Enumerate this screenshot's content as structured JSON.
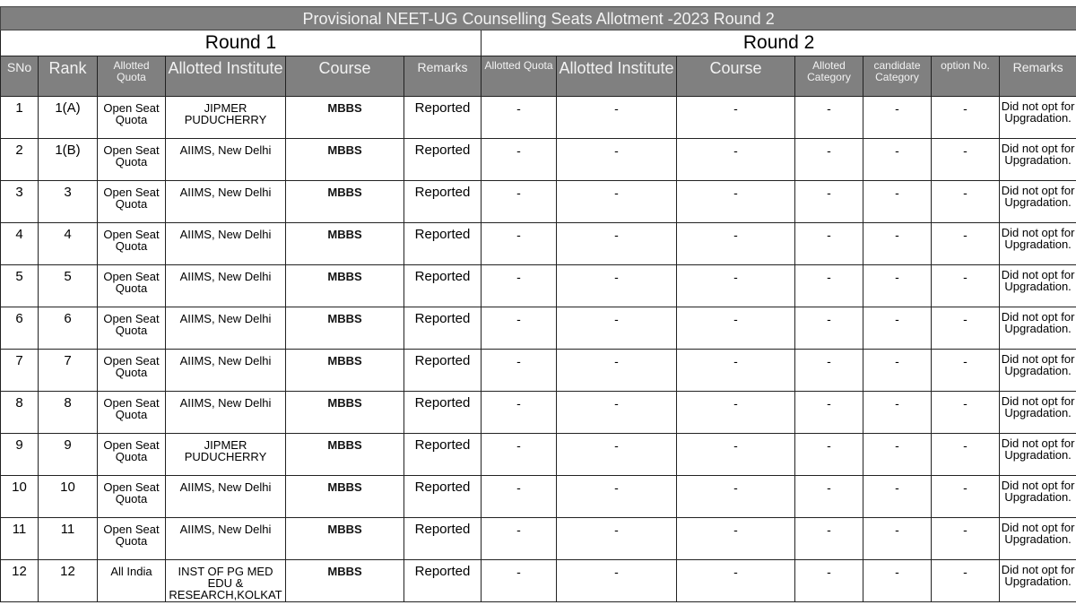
{
  "title": "Provisional NEET-UG  Counselling Seats Allotment -2023 Round 2",
  "round1_label": "Round 1",
  "round2_label": "Round 2",
  "headers": {
    "sno": "SNo",
    "rank": "Rank",
    "r1_quota": "Allotted Quota",
    "r1_institute": "Allotted Institute",
    "r1_course": "Course",
    "r1_remarks": "Remarks",
    "r2_quota": "Allotted Quota",
    "r2_institute": "Allotted Institute",
    "r2_course": "Course",
    "r2_alloted_category": "Alloted Category",
    "r2_candidate_category": "candidate Category",
    "r2_option_no": "option No.",
    "r2_remarks": "Remarks"
  },
  "rows": [
    {
      "sno": "1",
      "rank": "1(A)",
      "quota": "Open Seat Quota",
      "institute": "JIPMER PUDUCHERRY",
      "course": "MBBS",
      "remarks": "Reported",
      "r2_quota": "-",
      "r2_institute": "-",
      "r2_course": "-",
      "r2_alloted_category": "-",
      "r2_candidate_category": "-",
      "r2_option_no": "-",
      "r2_remarks": "Did not opt for Upgradation."
    },
    {
      "sno": "2",
      "rank": "1(B)",
      "quota": "Open Seat Quota",
      "institute": "AIIMS, New Delhi",
      "course": "MBBS",
      "remarks": "Reported",
      "r2_quota": "-",
      "r2_institute": "-",
      "r2_course": "-",
      "r2_alloted_category": "-",
      "r2_candidate_category": "-",
      "r2_option_no": "-",
      "r2_remarks": "Did not opt for Upgradation."
    },
    {
      "sno": "3",
      "rank": "3",
      "quota": "Open Seat Quota",
      "institute": "AIIMS, New Delhi",
      "course": "MBBS",
      "remarks": "Reported",
      "r2_quota": "-",
      "r2_institute": "-",
      "r2_course": "-",
      "r2_alloted_category": "-",
      "r2_candidate_category": "-",
      "r2_option_no": "-",
      "r2_remarks": "Did not opt for Upgradation."
    },
    {
      "sno": "4",
      "rank": "4",
      "quota": "Open Seat Quota",
      "institute": "AIIMS, New Delhi",
      "course": "MBBS",
      "remarks": "Reported",
      "r2_quota": "-",
      "r2_institute": "-",
      "r2_course": "-",
      "r2_alloted_category": "-",
      "r2_candidate_category": "-",
      "r2_option_no": "-",
      "r2_remarks": "Did not opt for Upgradation."
    },
    {
      "sno": "5",
      "rank": "5",
      "quota": "Open Seat Quota",
      "institute": "AIIMS, New Delhi",
      "course": "MBBS",
      "remarks": "Reported",
      "r2_quota": "-",
      "r2_institute": "-",
      "r2_course": "-",
      "r2_alloted_category": "-",
      "r2_candidate_category": "-",
      "r2_option_no": "-",
      "r2_remarks": "Did not opt for Upgradation."
    },
    {
      "sno": "6",
      "rank": "6",
      "quota": "Open Seat Quota",
      "institute": "AIIMS, New Delhi",
      "course": "MBBS",
      "remarks": "Reported",
      "r2_quota": "-",
      "r2_institute": "-",
      "r2_course": "-",
      "r2_alloted_category": "-",
      "r2_candidate_category": "-",
      "r2_option_no": "-",
      "r2_remarks": "Did not opt for Upgradation."
    },
    {
      "sno": "7",
      "rank": "7",
      "quota": "Open Seat Quota",
      "institute": "AIIMS, New Delhi",
      "course": "MBBS",
      "remarks": "Reported",
      "r2_quota": "-",
      "r2_institute": "-",
      "r2_course": "-",
      "r2_alloted_category": "-",
      "r2_candidate_category": "-",
      "r2_option_no": "-",
      "r2_remarks": "Did not opt for Upgradation."
    },
    {
      "sno": "8",
      "rank": "8",
      "quota": "Open Seat Quota",
      "institute": "AIIMS, New Delhi",
      "course": "MBBS",
      "remarks": "Reported",
      "r2_quota": "-",
      "r2_institute": "-",
      "r2_course": "-",
      "r2_alloted_category": "-",
      "r2_candidate_category": "-",
      "r2_option_no": "-",
      "r2_remarks": "Did not opt for Upgradation."
    },
    {
      "sno": "9",
      "rank": "9",
      "quota": "Open Seat Quota",
      "institute": "JIPMER PUDUCHERRY",
      "course": "MBBS",
      "remarks": "Reported",
      "r2_quota": "-",
      "r2_institute": "-",
      "r2_course": "-",
      "r2_alloted_category": "-",
      "r2_candidate_category": "-",
      "r2_option_no": "-",
      "r2_remarks": "Did not opt for Upgradation."
    },
    {
      "sno": "10",
      "rank": "10",
      "quota": "Open Seat Quota",
      "institute": "AIIMS, New Delhi",
      "course": "MBBS",
      "remarks": "Reported",
      "r2_quota": "-",
      "r2_institute": "-",
      "r2_course": "-",
      "r2_alloted_category": "-",
      "r2_candidate_category": "-",
      "r2_option_no": "-",
      "r2_remarks": "Did not opt for Upgradation."
    },
    {
      "sno": "11",
      "rank": "11",
      "quota": "Open Seat Quota",
      "institute": "AIIMS, New Delhi",
      "course": "MBBS",
      "remarks": "Reported",
      "r2_quota": "-",
      "r2_institute": "-",
      "r2_course": "-",
      "r2_alloted_category": "-",
      "r2_candidate_category": "-",
      "r2_option_no": "-",
      "r2_remarks": "Did not opt for Upgradation."
    },
    {
      "sno": "12",
      "rank": "12",
      "quota": "All India",
      "institute": "INST OF PG MED EDU & RESEARCH,KOLKAT",
      "course": "MBBS",
      "remarks": "Reported",
      "r2_quota": "-",
      "r2_institute": "-",
      "r2_course": "-",
      "r2_alloted_category": "-",
      "r2_candidate_category": "-",
      "r2_option_no": "-",
      "r2_remarks": "Did not opt for Upgradation."
    }
  ]
}
